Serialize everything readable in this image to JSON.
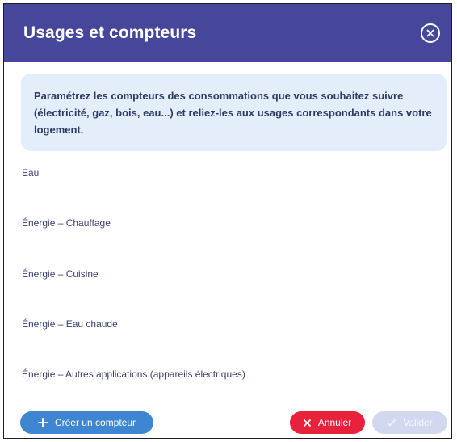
{
  "dialog": {
    "title": "Usages et compteurs",
    "close_icon": "close-circle-icon",
    "info_text": "Paramétrez les compteurs des consommations que vous souhaitez suivre (électricité, gaz, bois, eau...) et reliez-les aux usages correspondants dans votre logement."
  },
  "usages": [
    "Eau",
    "Énergie – Chauffage",
    "Énergie – Cuisine",
    "Énergie – Eau chaude",
    "Énergie – Autres applications (appareils électriques)"
  ],
  "footer": {
    "create_label": "Créer un compteur",
    "create_icon": "plus-icon",
    "cancel_label": "Annuler",
    "cancel_icon": "x-icon",
    "validate_label": "Valider",
    "validate_icon": "check-icon"
  },
  "colors": {
    "header": "#46479a",
    "info_background": "#e4eefb",
    "create_button": "#3f86d2",
    "cancel_button": "#e8223a",
    "validate_button_disabled": "#d2d8ef"
  }
}
